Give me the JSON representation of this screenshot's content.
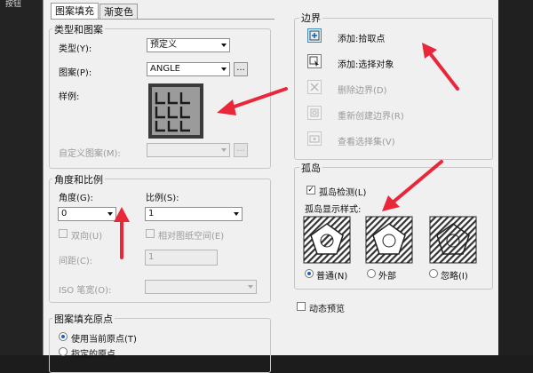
{
  "background": {
    "cut_label": "按钮"
  },
  "tabs": [
    {
      "label": "图案填充"
    },
    {
      "label": "渐变色"
    }
  ],
  "type_pattern": {
    "title": "类型和图案",
    "type_label": "类型(Y):",
    "type_value": "预定义",
    "pattern_label": "图案(P):",
    "pattern_value": "ANGLE",
    "browse_label": "...",
    "sample_label": "样例:",
    "custom_label": "自定义图案(M):",
    "custom_browse_label": "..."
  },
  "angle_scale": {
    "title": "角度和比例",
    "angle_label": "角度(G):",
    "angle_value": "0",
    "scale_label": "比例(S):",
    "scale_value": "1",
    "double_label": "双向(U)",
    "relative_label": "相对图纸空间(E)",
    "spacing_label": "间距(C):",
    "spacing_value": "1",
    "iso_label": "ISO 笔宽(O):"
  },
  "origin": {
    "title": "图案填充原点",
    "use_current_label": "使用当前原点(T)",
    "specified_label": "指定的原点"
  },
  "boundary": {
    "title": "边界",
    "add_pick_label": "添加:拾取点",
    "add_select_label": "添加:选择对象",
    "remove_label": "删除边界(D)",
    "recreate_label": "重新创建边界(R)",
    "view_label": "查看选择集(V)"
  },
  "island": {
    "title": "孤岛",
    "detect_label": "孤岛检测(L)",
    "style_label": "孤岛显示样式:",
    "normal_label": "普通(N)",
    "outer_label": "外部",
    "ignore_label": "忽略(I)"
  },
  "preview_label": "动态预览",
  "colors": {
    "annotation_arrow": "#e8283a",
    "selection": "#2060c0"
  }
}
